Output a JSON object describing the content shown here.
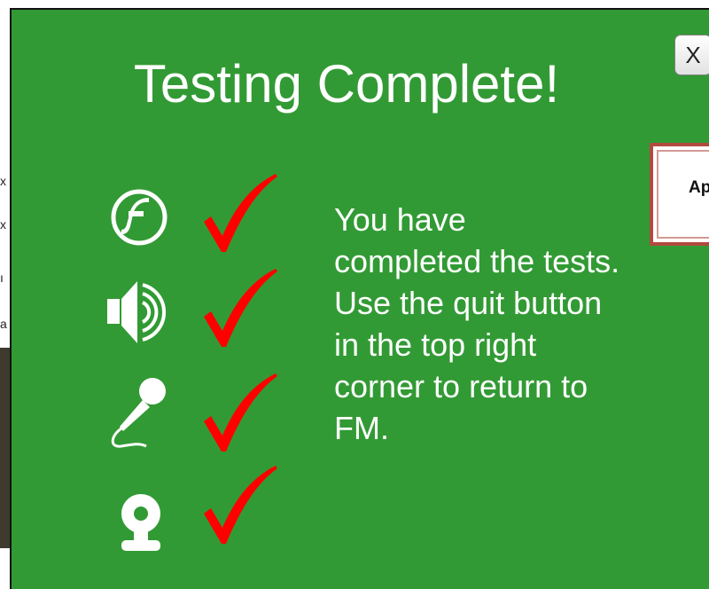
{
  "dialog": {
    "title": "Testing Complete!",
    "close_label": "X",
    "background_color": "#329a34",
    "message_lines": [
      "You have",
      "completed the tests.",
      "Use the quit button",
      "in the top right",
      "corner to return to",
      "FM."
    ]
  },
  "tests": [
    {
      "icon": "flash-icon",
      "status": "check-mark-icon"
    },
    {
      "icon": "speaker-icon",
      "status": "check-mark-icon"
    },
    {
      "icon": "microphone-icon",
      "status": "check-mark-icon"
    },
    {
      "icon": "webcam-icon",
      "status": "check-mark-icon"
    }
  ],
  "side_button": {
    "label": "Ap",
    "border_color": "#b24a3f"
  },
  "background_fragments": [
    "x",
    "x",
    "ı",
    "a"
  ],
  "colors": {
    "check": "#ff0000",
    "text": "#ffffff"
  }
}
